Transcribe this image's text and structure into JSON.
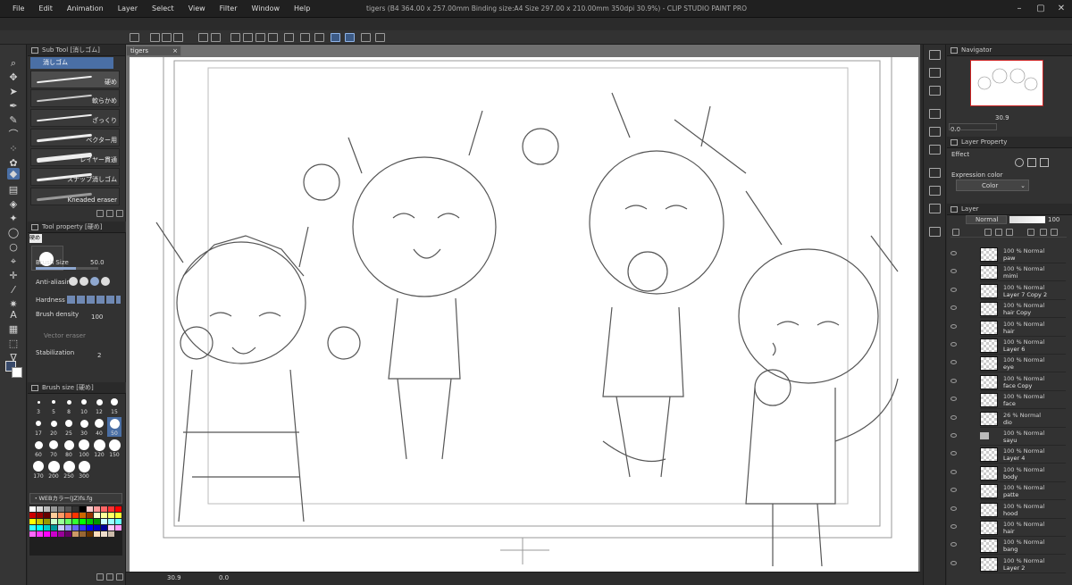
{
  "app": {
    "title": "tigers (B4 364.00 x 257.00mm Binding size:A4 Size 297.00 x 210.00mm 350dpi 30.9%) - CLIP STUDIO PAINT PRO",
    "menu": [
      "File",
      "Edit",
      "Animation",
      "Layer",
      "Select",
      "View",
      "Filter",
      "Window",
      "Help"
    ]
  },
  "document_tab": "tigers",
  "subtool": {
    "header": "Sub Tool [消しゴム]",
    "group": "消しゴム",
    "brushes": [
      {
        "label": "硬め"
      },
      {
        "label": "軟らかめ"
      },
      {
        "label": "ざっくり"
      },
      {
        "label": "ベクター用"
      },
      {
        "label": "レイヤー貫通"
      },
      {
        "label": "スナップ消しゴム"
      },
      {
        "label": "Kneaded eraser"
      }
    ]
  },
  "tool_property": {
    "header": "Tool property [硬め]",
    "tool_name": "硬め",
    "brush_size_label": "Brush Size",
    "brush_size": "50.0",
    "antialias_label": "Anti-aliasing",
    "hardness_label": "Hardness",
    "density_label": "Brush density",
    "density": "100",
    "vector_eraser_label": "Vector eraser",
    "stabilization_label": "Stabilization",
    "stabilization": "2"
  },
  "brush_size_palette": {
    "header": "Brush size [硬め]",
    "sizes": [
      "3",
      "5",
      "8",
      "10",
      "12",
      "15",
      "17",
      "20",
      "25",
      "30",
      "40",
      "50",
      "60",
      "70",
      "80",
      "100",
      "120",
      "150",
      "170",
      "200",
      "250",
      "300"
    ]
  },
  "color_set": {
    "name": "・WEBカラー(JZ)fs.fg"
  },
  "navigator": {
    "header": "Navigator",
    "zoom": "30.9",
    "angle": "0.0"
  },
  "layer_property": {
    "header": "Layer Property",
    "effect_label": "Effect",
    "expression_label": "Expression color",
    "expression_value": "Color"
  },
  "layer_panel": {
    "header": "Layer",
    "blend": "Normal",
    "opacity": "100",
    "layers": [
      {
        "pct": "100 % Normal",
        "name": "paw"
      },
      {
        "pct": "100 % Normal",
        "name": "mimi"
      },
      {
        "pct": "100 % Normal",
        "name": "Layer 7 Copy 2"
      },
      {
        "pct": "100 % Normal",
        "name": "hair Copy"
      },
      {
        "pct": "100 % Normal",
        "name": "hair"
      },
      {
        "pct": "100 % Normal",
        "name": "Layer 6"
      },
      {
        "pct": "100 % Normal",
        "name": "eye"
      },
      {
        "pct": "100 % Normal",
        "name": "face Copy"
      },
      {
        "pct": "100 % Normal",
        "name": "face"
      },
      {
        "pct": "26 % Normal",
        "name": "dio"
      },
      {
        "pct": "100 % Normal",
        "name": "sayu",
        "folder": true
      },
      {
        "pct": "100 % Normal",
        "name": "Layer 4"
      },
      {
        "pct": "100 % Normal",
        "name": "body"
      },
      {
        "pct": "100 % Normal",
        "name": "patte"
      },
      {
        "pct": "100 % Normal",
        "name": "hood"
      },
      {
        "pct": "100 % Normal",
        "name": "hair"
      },
      {
        "pct": "100 % Normal",
        "name": "bang"
      },
      {
        "pct": "100 % Normal",
        "name": "Layer 2"
      }
    ]
  },
  "status": {
    "zoom": "30.9",
    "angle": "0.0"
  }
}
